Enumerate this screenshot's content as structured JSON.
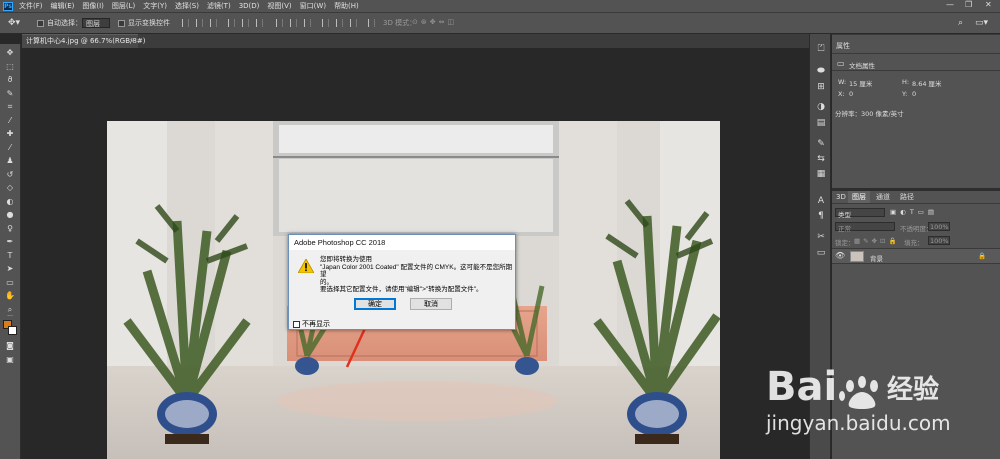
{
  "app": {
    "logo": "Ps"
  },
  "menubar": {
    "items": [
      "文件(F)",
      "编辑(E)",
      "图像(I)",
      "图层(L)",
      "文字(Y)",
      "选择(S)",
      "滤镜(T)",
      "3D(D)",
      "视图(V)",
      "窗口(W)",
      "帮助(H)"
    ],
    "window_controls": [
      "—",
      "❐",
      "✕"
    ]
  },
  "options": {
    "auto_select_label": "自动选择：",
    "auto_select_value": "图层",
    "show_transform_label": "显示变换控件",
    "mode_3d_label": "3D 模式："
  },
  "document_tab": {
    "title": "计算机中心4.jpg @ 66.7%(RGB/8#)",
    "close": "×"
  },
  "properties_panel": {
    "tab": "属性",
    "subtitle": "文档属性",
    "w_label": "W:",
    "w_value": "15 厘米",
    "h_label": "H:",
    "h_value": "8.64 厘米",
    "x_label": "X:",
    "x_value": "0",
    "y_label": "Y:",
    "y_value": "0",
    "resolution": "分辨率：300 像素/英寸"
  },
  "layers_panel": {
    "tabs": [
      "3D",
      "图层",
      "通道",
      "路径"
    ],
    "filter_kind": "类型",
    "blend_mode": "正常",
    "opacity_label": "不透明度：",
    "opacity_value": "100%",
    "lock_label": "锁定：",
    "fill_label": "填充：",
    "fill_value": "100%",
    "layer_name": "背景"
  },
  "dialog": {
    "title": "Adobe Photoshop CC 2018",
    "line1": "您即将转换为使用",
    "line2": "\"Japan Color 2001 Coated\" 配置文件的 CMYK。这可能不是您所期望",
    "line3": "的。",
    "line4": "要选择其它配置文件，请使用\"编辑\">\"转换为配置文件\"。",
    "ok_label": "确定",
    "cancel_label": "取消",
    "dont_show_label": "不再显示"
  },
  "watermark": {
    "brand_left": "Bai",
    "brand_right": "经验",
    "url": "jingyan.baidu.com"
  }
}
